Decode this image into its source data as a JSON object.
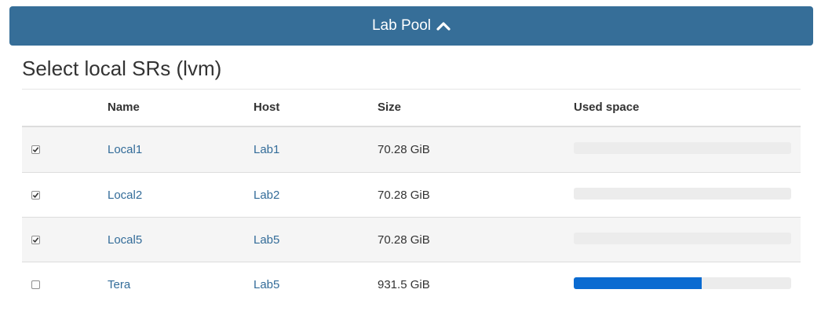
{
  "pool": {
    "title": "Lab Pool",
    "collapse_icon": "chevron-up-icon"
  },
  "section": {
    "title": "Select local SRs (lvm)"
  },
  "table": {
    "headers": {
      "name": "Name",
      "host": "Host",
      "size": "Size",
      "used": "Used space"
    },
    "rows": [
      {
        "checked": true,
        "name": "Local1",
        "host": "Lab1",
        "size": "70.28 GiB",
        "used_fraction": 0.0
      },
      {
        "checked": true,
        "name": "Local2",
        "host": "Lab2",
        "size": "70.28 GiB",
        "used_fraction": 0.0
      },
      {
        "checked": true,
        "name": "Local5",
        "host": "Lab5",
        "size": "70.28 GiB",
        "used_fraction": 0.0
      },
      {
        "checked": false,
        "name": "Tera",
        "host": "Lab5",
        "size": "931.5 GiB",
        "used_fraction": 0.59
      }
    ]
  },
  "colors": {
    "header_bg": "#366e98",
    "link": "#336c99",
    "progress_fill": "#0a6bd1",
    "progress_track": "#ececec",
    "row_stripe": "#f5f5f5"
  }
}
